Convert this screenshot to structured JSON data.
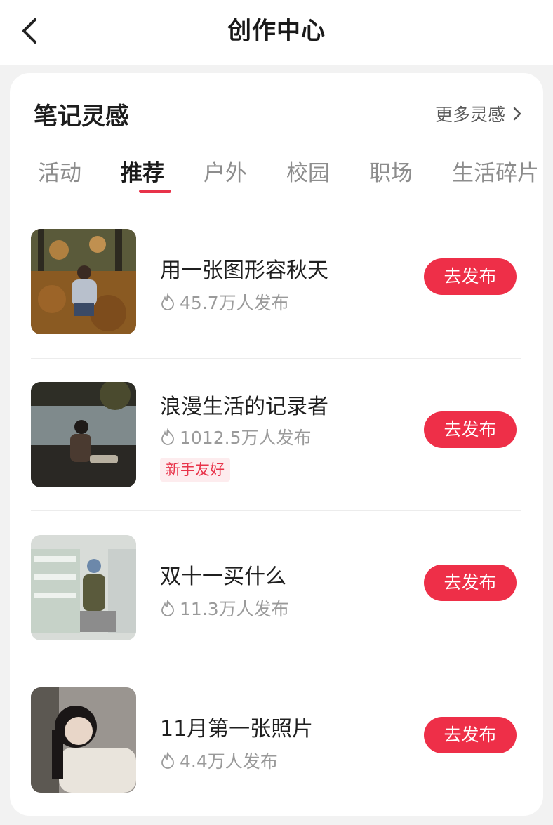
{
  "header": {
    "title": "创作中心"
  },
  "section": {
    "title": "笔记灵感",
    "more_label": "更多灵感"
  },
  "tabs": [
    {
      "label": "活动"
    },
    {
      "label": "推荐",
      "active": true
    },
    {
      "label": "户外"
    },
    {
      "label": "校园"
    },
    {
      "label": "职场"
    },
    {
      "label": "生活碎片"
    }
  ],
  "items": [
    {
      "title": "用一张图形容秋天",
      "count": "45.7万人发布",
      "badge": "",
      "button": "去发布"
    },
    {
      "title": "浪漫生活的记录者",
      "count": "1012.5万人发布",
      "badge": "新手友好",
      "button": "去发布"
    },
    {
      "title": "双十一买什么",
      "count": "11.3万人发布",
      "badge": "",
      "button": "去发布"
    },
    {
      "title": "11月第一张照片",
      "count": "4.4万人发布",
      "badge": "",
      "button": "去发布"
    }
  ],
  "colors": {
    "accent": "#ee2f48",
    "background": "#f2f2f2",
    "card": "#ffffff",
    "badge_bg": "#fdecee"
  },
  "icons": {
    "back": "chevron-left-icon",
    "more": "chevron-right-icon",
    "count": "flame-icon"
  }
}
